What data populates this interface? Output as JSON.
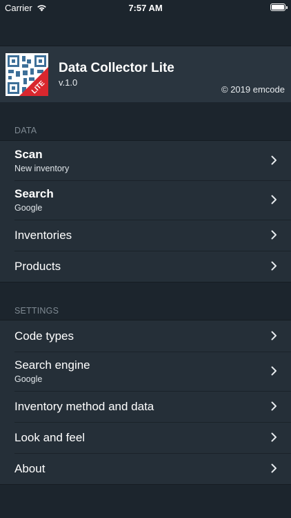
{
  "status": {
    "carrier": "Carrier",
    "time": "7:57 AM"
  },
  "header": {
    "title": "Data Collector Lite",
    "version": "v.1.0",
    "copyright": "© 2019 emcode",
    "badge": "LITE"
  },
  "sections": {
    "data": {
      "label": "DATA",
      "items": [
        {
          "title": "Scan",
          "subtitle": "New inventory"
        },
        {
          "title": "Search",
          "subtitle": "Google"
        },
        {
          "title": "Inventories"
        },
        {
          "title": "Products"
        }
      ]
    },
    "settings": {
      "label": "SETTINGS",
      "items": [
        {
          "title": "Code types"
        },
        {
          "title": "Search engine",
          "subtitle": "Google"
        },
        {
          "title": "Inventory method and data"
        },
        {
          "title": "Look and feel"
        },
        {
          "title": "About"
        }
      ]
    }
  },
  "colors": {
    "background": "#1c252d",
    "row": "#252f38",
    "header": "#2a353f",
    "section_label": "#7f8a93",
    "badge": "#d9272e"
  }
}
